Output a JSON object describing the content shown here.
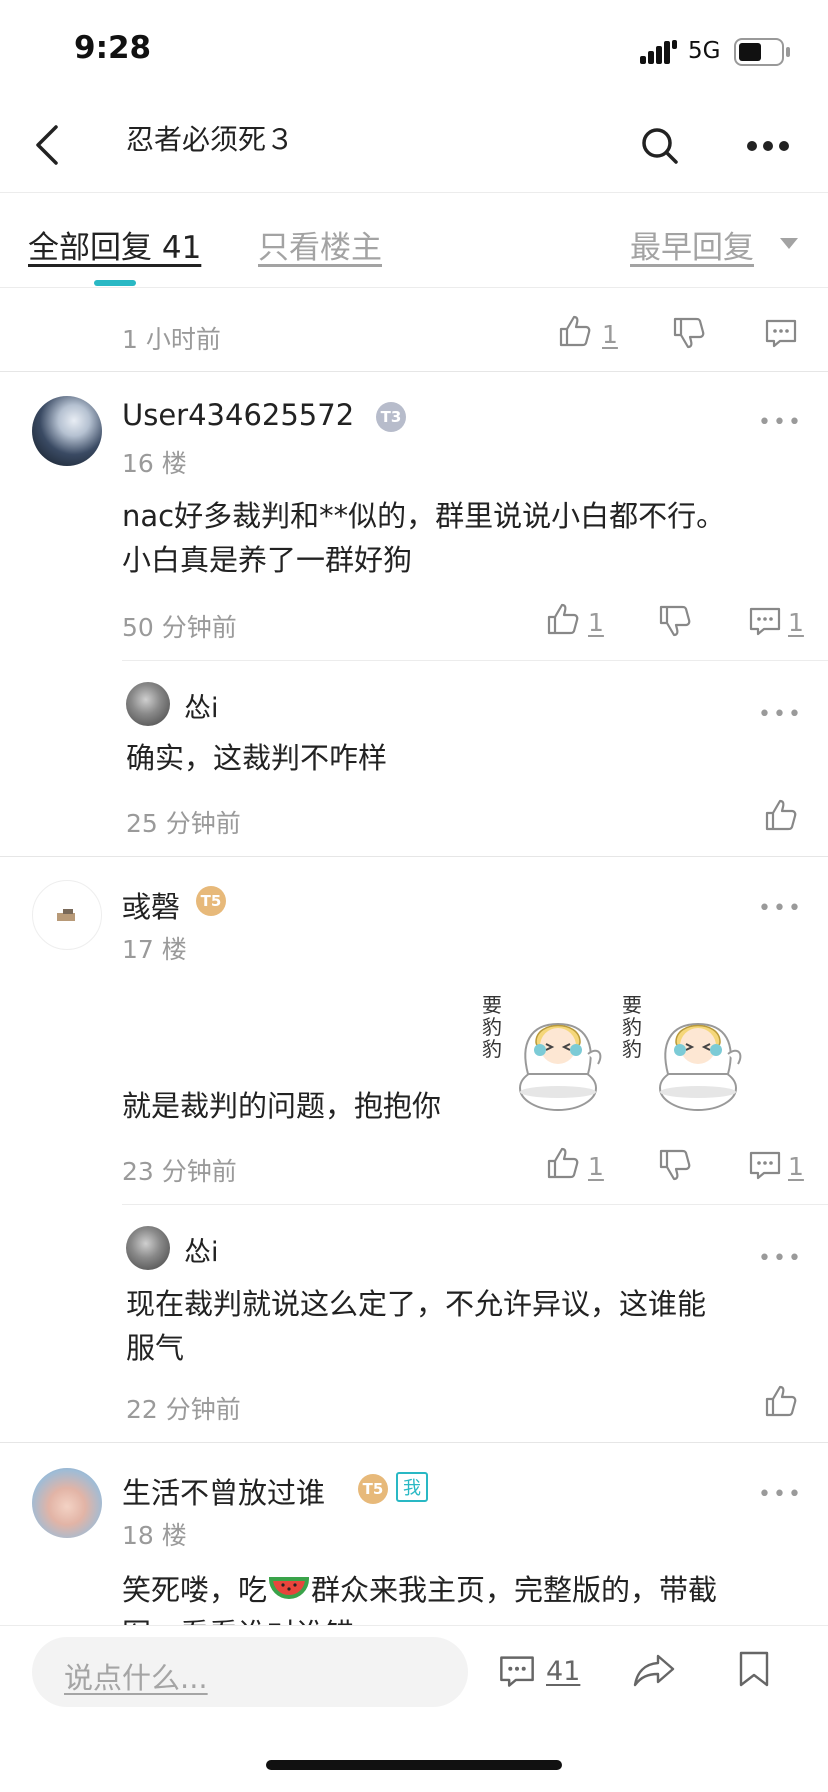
{
  "status_bar": {
    "time": "9:28",
    "network": "5G"
  },
  "header": {
    "title": "忍者必须死３"
  },
  "tabs": {
    "all_label": "全部回复 41",
    "op_only_label": "只看楼主",
    "sort_label": "最早回复"
  },
  "top_reply": {
    "time": "1 小时前",
    "like_count": "1"
  },
  "posts": [
    {
      "username": "User434625572",
      "floor": "16 楼",
      "level_badge": "T3",
      "content_line1": "nac好多裁判和**似的，群里说说小白都不行。",
      "content_line2": "小白真是养了一群好狗",
      "time": "50 分钟前",
      "like_count": "1",
      "reply_count": "1",
      "sub_reply": {
        "username": "怂i",
        "content": "确实，这裁判不咋样",
        "time": "25 分钟前"
      }
    },
    {
      "username": "彧磬",
      "floor": "17 楼",
      "level_badge": "T5",
      "content": "就是裁判的问题，抱抱你",
      "sticker_text": "要豹豹",
      "time": "23 分钟前",
      "like_count": "1",
      "reply_count": "1",
      "sub_reply": {
        "username": "怂i",
        "content_line1": "现在裁判就说这么定了，不允许异议，这谁能",
        "content_line2": "服气",
        "time": "22 分钟前"
      }
    },
    {
      "username": "生活不曾放过谁",
      "floor": "18 楼",
      "level_badge": "T5",
      "me_tag": "我",
      "content_before": "笑死喽，吃",
      "content_after": "群众来我主页，完整版的，带截",
      "content_line2": "图，看看谁对谁错"
    }
  ],
  "bottom_bar": {
    "placeholder": "说点什么...",
    "comment_count": "41"
  },
  "colors": {
    "accent": "#29b8c4",
    "text": "#222222",
    "muted": "#9a9a9a",
    "badge_silver": "#b7bccb",
    "badge_gold": "#e7b97a"
  }
}
